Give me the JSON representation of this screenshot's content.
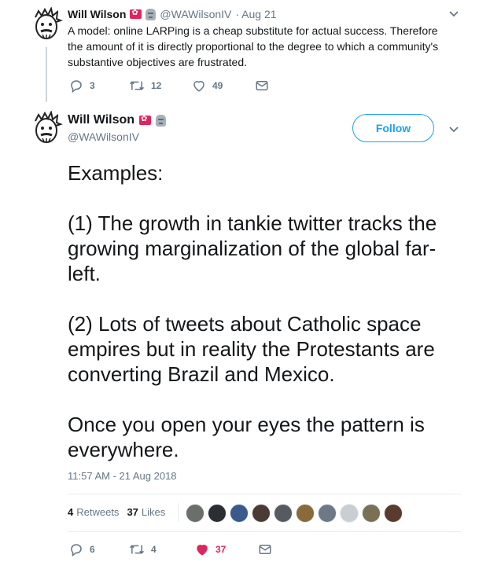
{
  "parent_tweet": {
    "author_name": "Will Wilson",
    "author_handle": "@WAWilsonIV",
    "date": "· Aug 21",
    "text": "A model: online LARPing is a cheap substitute for actual success. Therefore the amount of it is directly proportional to the degree to which a community's substantive objectives are frustrated.",
    "replies": "3",
    "retweets": "12",
    "likes": "49"
  },
  "main_tweet": {
    "author_name": "Will Wilson",
    "author_handle": "@WAWilsonIV",
    "follow_label": "Follow",
    "text": "Examples:\n\n(1) The growth in tankie twitter tracks the growing marginalization of the global far-left.\n\n(2) Lots of tweets about Catholic space empires but in reality the Protestants are converting Brazil and Mexico.\n\nOnce you open your eyes the pattern is everywhere.",
    "timestamp": "11:57 AM - 21 Aug 2018",
    "retweet_count": "4",
    "retweet_label": "Retweets",
    "like_count": "37",
    "like_label": "Likes",
    "replies": "6",
    "retweets": "4",
    "likes": "37"
  },
  "likers": [
    {
      "color": "#6b6f6a"
    },
    {
      "color": "#2b2f33"
    },
    {
      "color": "#3a5a8c"
    },
    {
      "color": "#4a3c34"
    },
    {
      "color": "#555b61"
    },
    {
      "color": "#8a6a3a"
    },
    {
      "color": "#6d7a86"
    },
    {
      "color": "#c9ced3"
    },
    {
      "color": "#7a7055"
    },
    {
      "color": "#5b3b2e"
    }
  ],
  "colors": {
    "accent": "#1da1f2",
    "like_active": "#e0245e",
    "muted": "#657786"
  }
}
